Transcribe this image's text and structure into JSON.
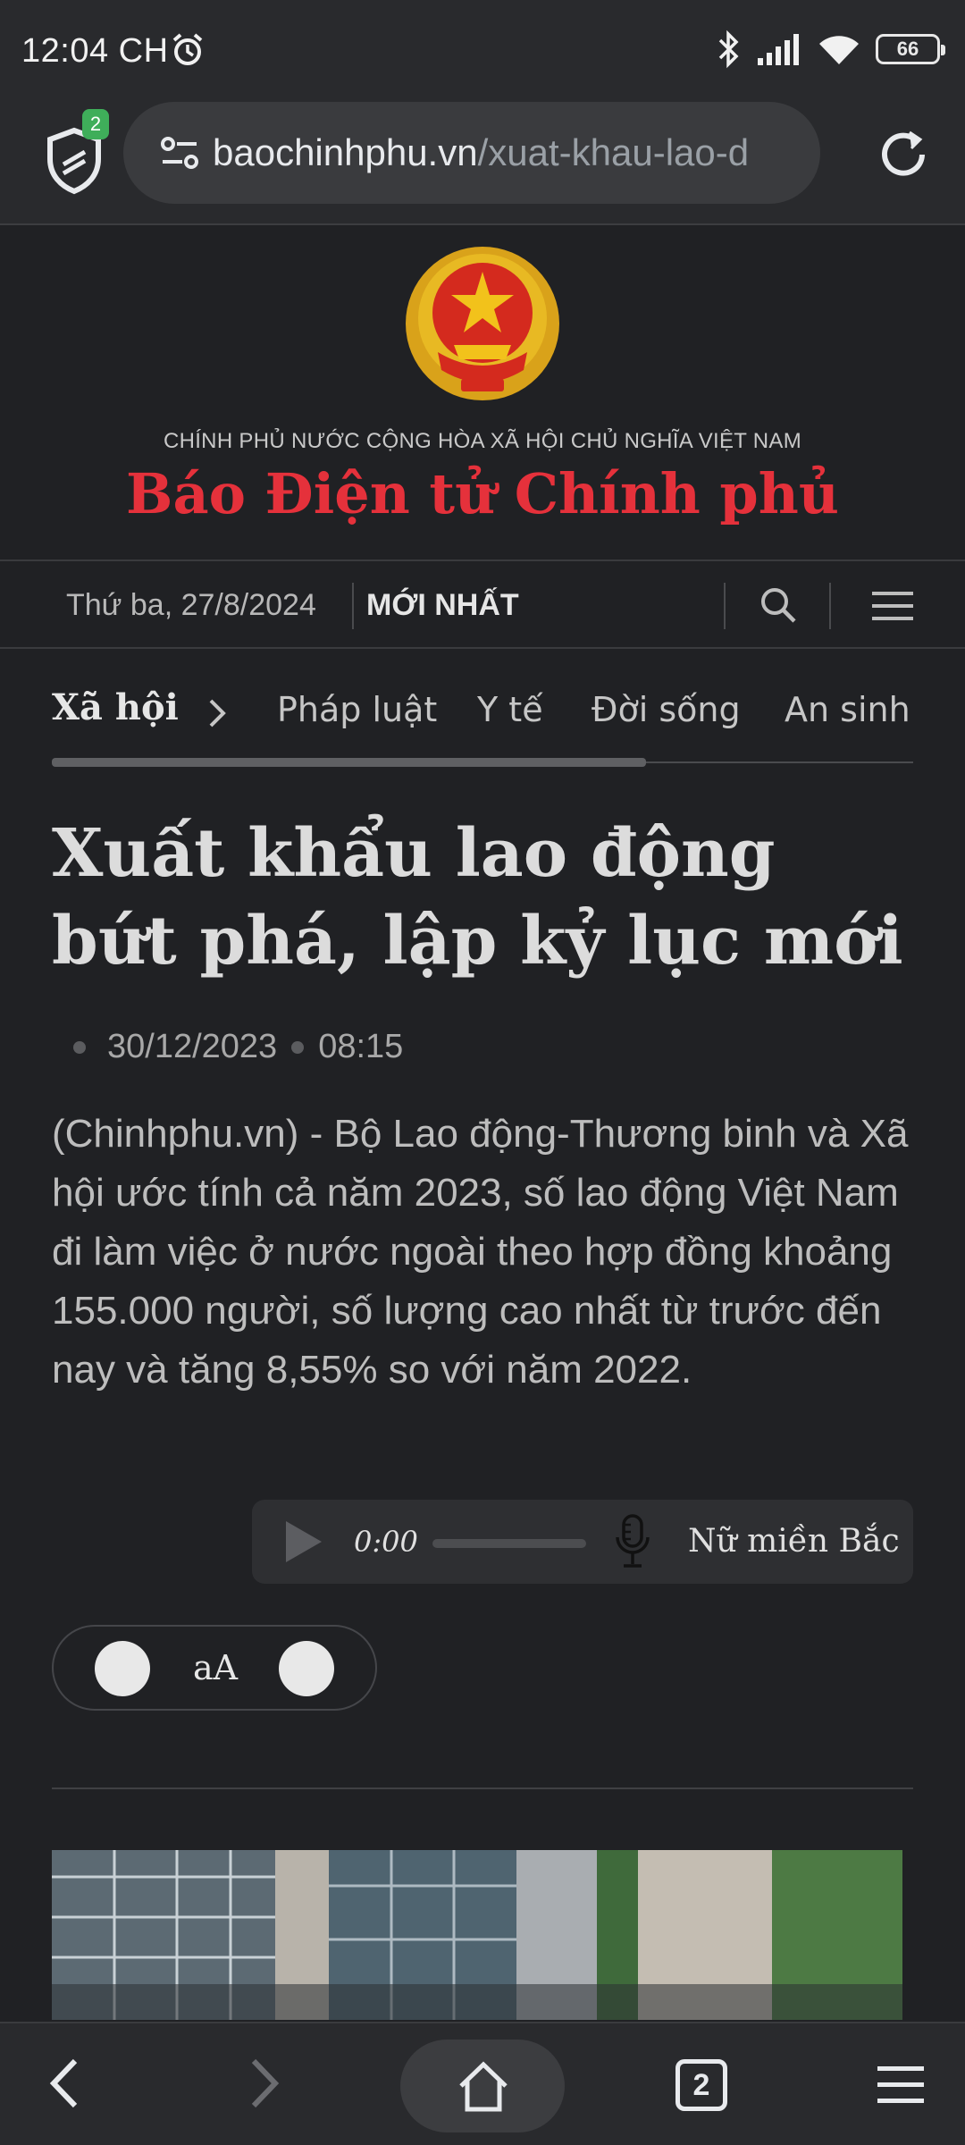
{
  "status_bar": {
    "time": "12:04 CH",
    "battery": "66",
    "icons": [
      "alarm-icon",
      "bluetooth-icon",
      "signal-icon",
      "wifi-icon",
      "battery-icon"
    ]
  },
  "browser": {
    "shield_badge": "2",
    "url_host": "baochinhphu.vn",
    "url_path": "/xuat-khau-lao-d",
    "tab_count": "2"
  },
  "masthead": {
    "government_line": "CHÍNH PHỦ NƯỚC CỘNG HÒA XÃ HỘI CHỦ NGHĨA VIỆT NAM",
    "site_name": "Báo Điện tử Chính phủ",
    "brand_color": "#e5313b"
  },
  "navbar": {
    "date": "Thứ ba, 27/8/2024",
    "latest": "MỚI NHẤT"
  },
  "categories": {
    "current": "Xã hội",
    "items": [
      "Pháp luật",
      "Y tế",
      "Đời sống",
      "An sinh"
    ],
    "scroll_position": 0.69
  },
  "article": {
    "headline": "Xuất khẩu lao động bứt phá, lập kỷ lục mới",
    "date": "30/12/2023",
    "time": "08:15",
    "lead": "(Chinhphu.vn) - Bộ Lao động-Thương binh và Xã hội ước tính cả năm 2023, số lao động Việt Nam đi làm việc ở nước ngoài theo hợp đồng khoảng 155.000 người, số lượng cao nhất từ trước đến nay và tăng 8,55% so với năm 2022."
  },
  "audio_player": {
    "time": "0:00",
    "voice": "Nữ miền Bắc",
    "progress": 0
  },
  "font_control": {
    "label": "aA"
  }
}
